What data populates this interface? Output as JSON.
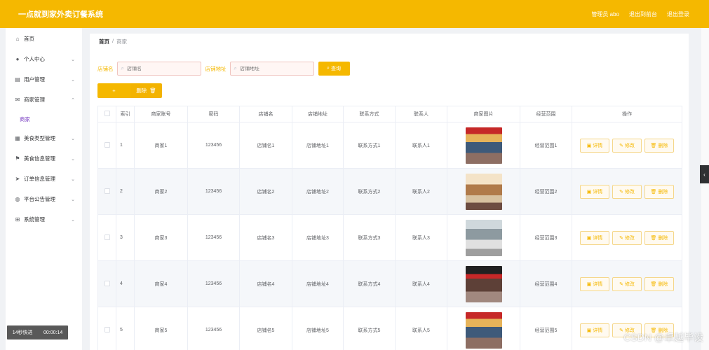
{
  "app": {
    "title": "一点就到家外卖订餐系统"
  },
  "header": {
    "user_label": "管理员 abo",
    "front_link": "退出到前台",
    "logout_link": "退出登录"
  },
  "sidebar": {
    "items": [
      {
        "label": "首页",
        "icon": "home-icon",
        "glyph": "⌂",
        "chevron": ""
      },
      {
        "label": "个人中心",
        "icon": "user-icon",
        "glyph": "●",
        "chevron": "⌄"
      },
      {
        "label": "用户管理",
        "icon": "users-icon",
        "glyph": "▤",
        "chevron": "⌄"
      },
      {
        "label": "商家管理",
        "icon": "mail-icon",
        "glyph": "✉",
        "chevron": "⌃"
      },
      {
        "label": "美食类型管理",
        "icon": "grid-icon",
        "glyph": "▦",
        "chevron": "⌄"
      },
      {
        "label": "美食信息管理",
        "icon": "flag-icon",
        "glyph": "⚑",
        "chevron": "⌄"
      },
      {
        "label": "订单信息管理",
        "icon": "send-icon",
        "glyph": "➤",
        "chevron": "⌄"
      },
      {
        "label": "平台公告管理",
        "icon": "globe-icon",
        "glyph": "◍",
        "chevron": "⌄"
      },
      {
        "label": "系统管理",
        "icon": "apps-icon",
        "glyph": "⊞",
        "chevron": "⌄"
      }
    ],
    "submenu": {
      "label": "商家"
    }
  },
  "breadcrumb": {
    "home": "首页",
    "sep": "/",
    "current": "商家"
  },
  "search": {
    "name_label": "店铺名",
    "name_placeholder": "店铺名",
    "addr_label": "店铺地址",
    "addr_placeholder": "店铺地址",
    "button": "查询"
  },
  "actions": {
    "add": "+",
    "delete": "删除"
  },
  "table": {
    "columns": [
      "",
      "索引",
      "商家账号",
      "密码",
      "店铺名",
      "店铺地址",
      "联系方式",
      "联系人",
      "商家图片",
      "经营范围",
      "操作"
    ],
    "rows": [
      {
        "index": "1",
        "account": "商家1",
        "password": "123456",
        "shop_name": "店铺名1",
        "shop_addr": "店铺地址1",
        "contact": "联系方式1",
        "person": "联系人1",
        "scope": "经营范围1"
      },
      {
        "index": "2",
        "account": "商家2",
        "password": "123456",
        "shop_name": "店铺名2",
        "shop_addr": "店铺地址2",
        "contact": "联系方式2",
        "person": "联系人2",
        "scope": "经营范围2"
      },
      {
        "index": "3",
        "account": "商家3",
        "password": "123456",
        "shop_name": "店铺名3",
        "shop_addr": "店铺地址3",
        "contact": "联系方式3",
        "person": "联系人3",
        "scope": "经营范围3"
      },
      {
        "index": "4",
        "account": "商家4",
        "password": "123456",
        "shop_name": "店铺名4",
        "shop_addr": "店铺地址4",
        "contact": "联系方式4",
        "person": "联系人4",
        "scope": "经营范围4"
      },
      {
        "index": "5",
        "account": "商家5",
        "password": "123456",
        "shop_name": "店铺名5",
        "shop_addr": "店铺地址5",
        "contact": "联系方式5",
        "person": "联系人5",
        "scope": "经营范围5"
      }
    ],
    "op_detail": "详情",
    "op_edit": "修改",
    "op_delete": "删除"
  },
  "overlay": {
    "speed_label": "14秒快进",
    "time": "00:00:14",
    "watermark": "CSDN @卓越毕设"
  },
  "colors": {
    "accent": "#f5b800",
    "submenu": "#7a3ec2"
  }
}
